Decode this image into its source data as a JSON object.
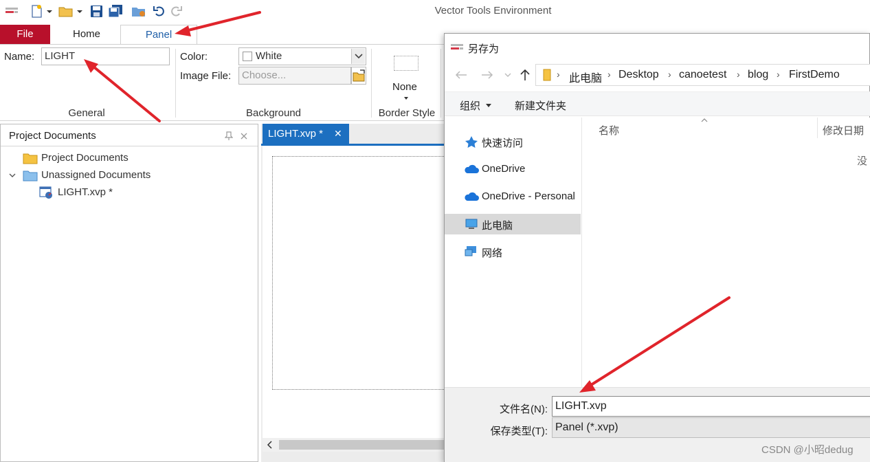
{
  "window": {
    "title": "Vector Tools Environment"
  },
  "quick_access": {
    "icons": [
      "app-menu-icon",
      "new-document-icon",
      "open-folder-icon",
      "save-icon",
      "save-all-icon",
      "configuration-icon",
      "undo-icon",
      "redo-icon"
    ]
  },
  "ribbon": {
    "tabs": {
      "file": "File",
      "home": "Home",
      "panel": "Panel"
    },
    "general": {
      "name_label": "Name:",
      "name_value": "LIGHT",
      "caption": "General"
    },
    "background": {
      "color_label": "Color:",
      "color_value": "White",
      "image_label": "Image File:",
      "image_placeholder": "Choose...",
      "caption": "Background"
    },
    "border_style": {
      "value": "None",
      "caption": "Border Style"
    }
  },
  "project_pane": {
    "title": "Project Documents",
    "tree": [
      {
        "label": "Project Documents"
      },
      {
        "label": "Unassigned Documents"
      },
      {
        "label": "LIGHT.xvp *"
      }
    ]
  },
  "editor": {
    "tab_label": "LIGHT.xvp *",
    "close_glyph": "✕"
  },
  "save_dialog": {
    "title": "另存为",
    "breadcrumb": [
      "此电脑",
      "Desktop",
      "canoetest",
      "blog",
      "FirstDemo"
    ],
    "toolbar": {
      "organize": "组织",
      "new_folder": "新建文件夹"
    },
    "nav_items": [
      {
        "label": "快速访问",
        "icon": "star-icon"
      },
      {
        "label": "OneDrive",
        "icon": "cloud-icon"
      },
      {
        "label": "OneDrive - Personal",
        "icon": "cloud-icon"
      },
      {
        "label": "此电脑",
        "icon": "computer-icon"
      },
      {
        "label": "网络",
        "icon": "network-icon"
      }
    ],
    "selected_nav": "此电脑",
    "columns": {
      "name": "名称",
      "modified": "修改日期"
    },
    "empty_text": "没",
    "filename_label": "文件名(N):",
    "filename_value": "LIGHT.xvp",
    "filetype_label": "保存类型(T):",
    "filetype_value": "Panel (*.xvp)"
  },
  "watermark": "CSDN @小昭dedug",
  "colors": {
    "file_tab": "#b8102b",
    "panel_tab_text": "#1f5fa8",
    "editor_tab": "#1c6fc0",
    "annotation_arrow": "#e0242b"
  }
}
